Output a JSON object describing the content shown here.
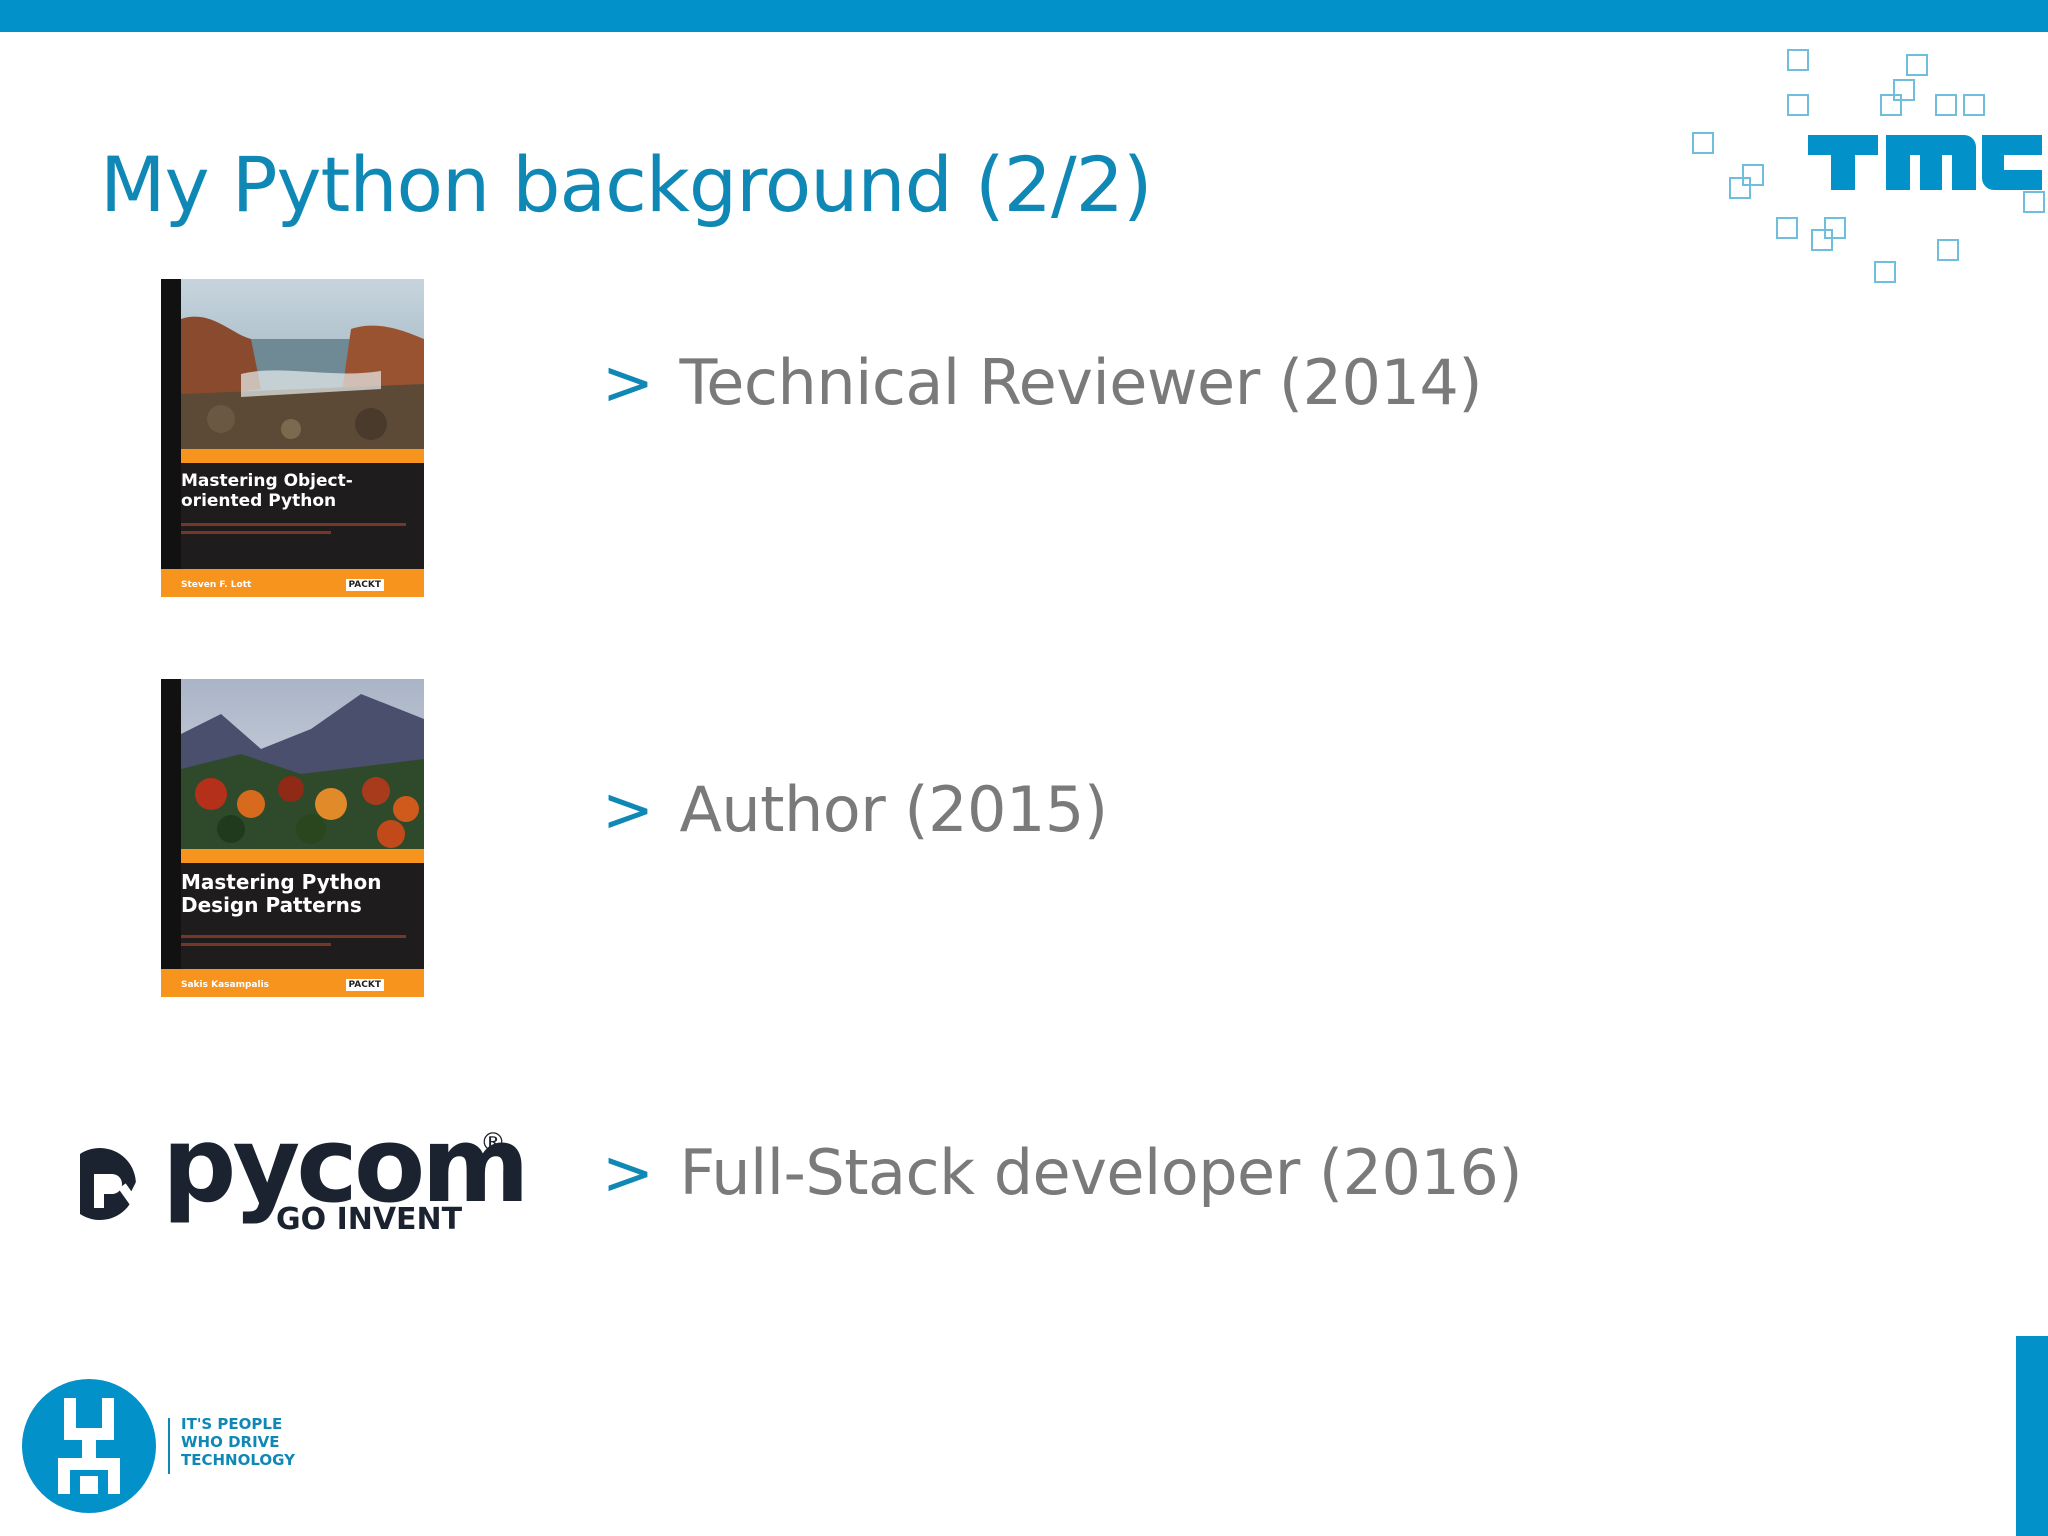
{
  "slide": {
    "title": "My Python background (2/2)"
  },
  "bullets": [
    {
      "arrow": ">",
      "text": "Technical Reviewer (2014)"
    },
    {
      "arrow": ">",
      "text": "Author (2015)"
    },
    {
      "arrow": ">",
      "text": "Full-Stack developer (2016)"
    }
  ],
  "books": [
    {
      "title": "Mastering Object-oriented Python",
      "author": "Steven F. Lott",
      "publisher": "PACKT"
    },
    {
      "title": "Mastering Python Design Patterns",
      "author": "Sakis Kasampalis",
      "publisher": "PACKT"
    }
  ],
  "pycom": {
    "name": "pycom",
    "registered": "®",
    "tagline": "GO INVENT"
  },
  "tmc": {
    "name": "TMC"
  },
  "footer_logo": {
    "line1": "IT'S PEOPLE",
    "line2": "WHO DRIVE",
    "line3": "TECHNOLOGY"
  },
  "colors": {
    "accent": "#0391c9",
    "title": "#0f88b5",
    "bullet_text": "#7a7a7a",
    "book_orange": "#f7941d"
  }
}
